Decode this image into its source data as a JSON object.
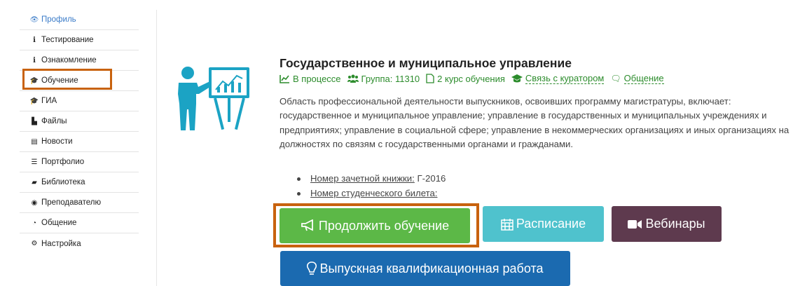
{
  "sidebar": {
    "items": [
      {
        "label": "Профиль",
        "icon": "eye-icon",
        "glyph": "👁",
        "active": true
      },
      {
        "label": "Тестирование",
        "icon": "info-icon",
        "glyph": "i",
        "active": false
      },
      {
        "label": "Ознакомление",
        "icon": "info-icon",
        "glyph": "i",
        "active": false
      },
      {
        "label": "Обучение",
        "icon": "graduation-cap-icon",
        "glyph": "🎓",
        "active": false
      },
      {
        "label": "ГИА",
        "icon": "graduation-cap-icon",
        "glyph": "🎓",
        "active": false
      },
      {
        "label": "Файлы",
        "icon": "file-icon",
        "glyph": "▙",
        "active": false
      },
      {
        "label": "Новости",
        "icon": "newspaper-icon",
        "glyph": "▤",
        "active": false
      },
      {
        "label": "Портфолио",
        "icon": "list-icon",
        "glyph": "☰",
        "active": false
      },
      {
        "label": "Библиотека",
        "icon": "book-icon",
        "glyph": "▰",
        "active": false
      },
      {
        "label": "Преподавателю",
        "icon": "user-circle-icon",
        "glyph": "◉",
        "active": false
      },
      {
        "label": "Общение",
        "icon": "chat-icon",
        "glyph": "◔",
        "active": false
      },
      {
        "label": "Настройка",
        "icon": "gears-icon",
        "glyph": "⚙",
        "active": false
      }
    ]
  },
  "program": {
    "title": "Государственное и муниципальное управление",
    "status": "В процессе",
    "group": "Группа: 11310",
    "course": "2 курс обучения",
    "curator_link": "Связь с куратором",
    "chat_link": "Общение",
    "description": "Область профессиональной деятельности выпускников, освоивших программу магистратуры, включает: государственное и муниципальное управление; управление в государственных и муниципальных учреждениях и предприятиях; управление в социальной сфере; управление в некоммерческих организациях и иных организациях на должностях по связям с государственными органами и гражданами.",
    "record_book_label": "Номер зачетной книжки:",
    "record_book_value": " Г-2016",
    "student_card_label": "Номер студенческого билета:"
  },
  "buttons": {
    "continue": "Продолжить обучение",
    "schedule": "Расписание",
    "webinars": "Вебинары",
    "thesis": "Выпускная квалификационная работа"
  },
  "colors": {
    "accent_green": "#5cb847",
    "teal": "#4fc2cd",
    "plum": "#5e3a4e",
    "blue": "#1b6ab0",
    "highlight_orange": "#c8620e",
    "link_blue": "#3a7bc8",
    "icon_teal": "#1ba3c4"
  }
}
